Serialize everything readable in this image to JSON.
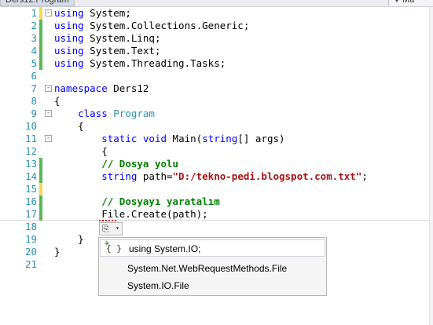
{
  "tabs": {
    "document": "Ders12.Program",
    "member_short": "Ma"
  },
  "lines": [
    {
      "num": "1",
      "change": "yellow",
      "fold": "-",
      "tokens": [
        {
          "t": "using",
          "c": "kw"
        },
        {
          "t": " System;",
          "c": ""
        }
      ]
    },
    {
      "num": "2",
      "change": "green",
      "fold": "",
      "tokens": [
        {
          "t": "using",
          "c": "kw"
        },
        {
          "t": " System.Collections.Generic;",
          "c": ""
        }
      ]
    },
    {
      "num": "3",
      "change": "green",
      "fold": "",
      "tokens": [
        {
          "t": "using",
          "c": "kw"
        },
        {
          "t": " System.Linq;",
          "c": ""
        }
      ]
    },
    {
      "num": "4",
      "change": "green",
      "fold": "",
      "tokens": [
        {
          "t": "using",
          "c": "kw"
        },
        {
          "t": " System.Text;",
          "c": ""
        }
      ]
    },
    {
      "num": "5",
      "change": "green",
      "fold": "",
      "tokens": [
        {
          "t": "using",
          "c": "kw"
        },
        {
          "t": " System.Threading.Tasks;",
          "c": ""
        }
      ]
    },
    {
      "num": "6",
      "change": "",
      "fold": "",
      "tokens": []
    },
    {
      "num": "7",
      "change": "",
      "fold": "-",
      "tokens": [
        {
          "t": "namespace",
          "c": "kw"
        },
        {
          "t": " Ders12",
          "c": ""
        }
      ]
    },
    {
      "num": "8",
      "change": "",
      "fold": "",
      "tokens": [
        {
          "t": "{",
          "c": ""
        }
      ]
    },
    {
      "num": "9",
      "change": "",
      "fold": "-",
      "tokens": [
        {
          "t": "    ",
          "c": ""
        },
        {
          "t": "class",
          "c": "kw"
        },
        {
          "t": " ",
          "c": ""
        },
        {
          "t": "Program",
          "c": "ty"
        }
      ]
    },
    {
      "num": "10",
      "change": "",
      "fold": "",
      "tokens": [
        {
          "t": "    {",
          "c": ""
        }
      ]
    },
    {
      "num": "11",
      "change": "",
      "fold": "-",
      "tokens": [
        {
          "t": "        ",
          "c": ""
        },
        {
          "t": "static",
          "c": "kw"
        },
        {
          "t": " ",
          "c": ""
        },
        {
          "t": "void",
          "c": "kw"
        },
        {
          "t": " Main(",
          "c": ""
        },
        {
          "t": "string",
          "c": "kw"
        },
        {
          "t": "[] args)",
          "c": ""
        }
      ]
    },
    {
      "num": "12",
      "change": "",
      "fold": "",
      "tokens": [
        {
          "t": "        {",
          "c": ""
        }
      ]
    },
    {
      "num": "13",
      "change": "green",
      "fold": "",
      "tokens": [
        {
          "t": "        ",
          "c": ""
        },
        {
          "t": "// Dosya yolu",
          "c": "cm"
        }
      ]
    },
    {
      "num": "14",
      "change": "green",
      "fold": "",
      "tokens": [
        {
          "t": "        ",
          "c": ""
        },
        {
          "t": "string",
          "c": "kw"
        },
        {
          "t": " path=",
          "c": ""
        },
        {
          "t": "\"D:/tekno-pedi.blogspot.com.txt\"",
          "c": "st"
        },
        {
          "t": ";",
          "c": ""
        }
      ]
    },
    {
      "num": "15",
      "change": "yellow",
      "fold": "",
      "tokens": []
    },
    {
      "num": "16",
      "change": "green",
      "fold": "",
      "tokens": [
        {
          "t": "        ",
          "c": ""
        },
        {
          "t": "// Dosyayı yaratalım",
          "c": "cm"
        }
      ]
    },
    {
      "num": "17",
      "change": "green",
      "fold": "",
      "tokens": [
        {
          "t": "        File.Create(path);",
          "c": ""
        }
      ]
    },
    {
      "num": "18",
      "change": "",
      "fold": "",
      "tokens": []
    },
    {
      "num": "19",
      "change": "",
      "fold": "",
      "tokens": [
        {
          "t": "    }",
          "c": ""
        }
      ]
    },
    {
      "num": "20",
      "change": "",
      "fold": "",
      "tokens": [
        {
          "t": "}",
          "c": ""
        }
      ]
    },
    {
      "num": "21",
      "change": "",
      "fold": "",
      "tokens": []
    }
  ],
  "smart_tag": {
    "icon": "light-bulb-icon",
    "arrow": "▾",
    "glyph": "⎘"
  },
  "quick_actions": [
    {
      "label": "using System.IO;",
      "icon": "{ }",
      "plus": "+",
      "selected": true
    },
    {
      "label": "System.Net.WebRequestMethods.File",
      "icon": "",
      "plus": "",
      "selected": false
    },
    {
      "label": "System.IO.File",
      "icon": "",
      "plus": "",
      "selected": false
    }
  ]
}
